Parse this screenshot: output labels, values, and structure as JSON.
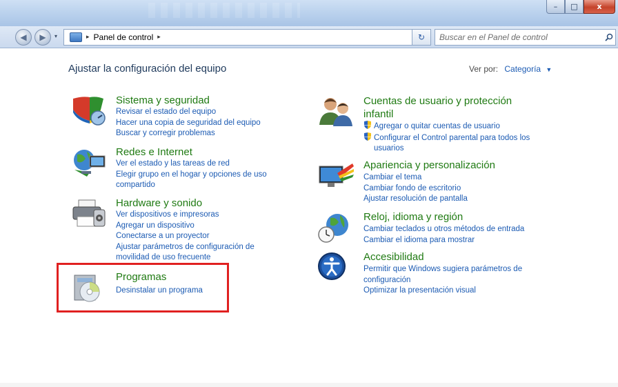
{
  "window": {
    "minimize_glyph": "–",
    "maximize_glyph": "□",
    "close_glyph": "x"
  },
  "nav": {
    "back_glyph": "◀",
    "forward_glyph": "▶",
    "dropdown_glyph": "▾",
    "breadcrumb_sep": "▸",
    "breadcrumb": "Panel de control",
    "breadcrumb_trailing_sep": "▸",
    "address_dropdown_glyph": "▾",
    "refresh_glyph": "↻",
    "search_placeholder": "Buscar en el Panel de control"
  },
  "main": {
    "heading": "Ajustar la configuración del equipo",
    "view_by_label": "Ver por:",
    "view_by_value": "Categoría",
    "view_by_arrow": "▼"
  },
  "categories": [
    {
      "title": "Sistema y seguridad",
      "icon": "shield-icon",
      "links": [
        "Revisar el estado del equipo",
        "Hacer una copia de seguridad del equipo",
        "Buscar y corregir problemas"
      ]
    },
    {
      "title": "Redes e Internet",
      "icon": "network-icon",
      "links": [
        "Ver el estado y las tareas de red",
        "Elegir grupo en el hogar y opciones de uso",
        "compartido"
      ]
    },
    {
      "title": "Hardware y sonido",
      "icon": "printer-icon",
      "links": [
        "Ver dispositivos e impresoras",
        "Agregar un dispositivo",
        "Conectarse a un proyector",
        "Ajustar parámetros de configuración de",
        "movilidad de uso frecuente"
      ]
    },
    {
      "title": "Programas",
      "icon": "programs-icon",
      "links": [
        "Desinstalar un programa"
      ]
    },
    {
      "title_line1": "Cuentas de usuario y protección",
      "title_line2": "infantil",
      "icon": "users-icon",
      "links": [
        "Agregar o quitar cuentas de usuario",
        "Configurar el Control parental para todos los",
        "usuarios"
      ]
    },
    {
      "title": "Apariencia y personalización",
      "icon": "appearance-icon",
      "links": [
        "Cambiar el tema",
        "Cambiar fondo de escritorio",
        "Ajustar resolución de pantalla"
      ]
    },
    {
      "title": "Reloj, idioma y región",
      "icon": "globe-clock-icon",
      "links": [
        "Cambiar teclados u otros métodos de entrada",
        "Cambiar el idioma para mostrar"
      ]
    },
    {
      "title": "Accesibilidad",
      "icon": "accessibility-icon",
      "links": [
        "Permitir que Windows sugiera parámetros de",
        "configuración",
        "Optimizar la presentación visual"
      ]
    }
  ],
  "colors": {
    "category_title": "#1f7a12",
    "link": "#1c5bb3",
    "highlight_box": "#e02020"
  }
}
